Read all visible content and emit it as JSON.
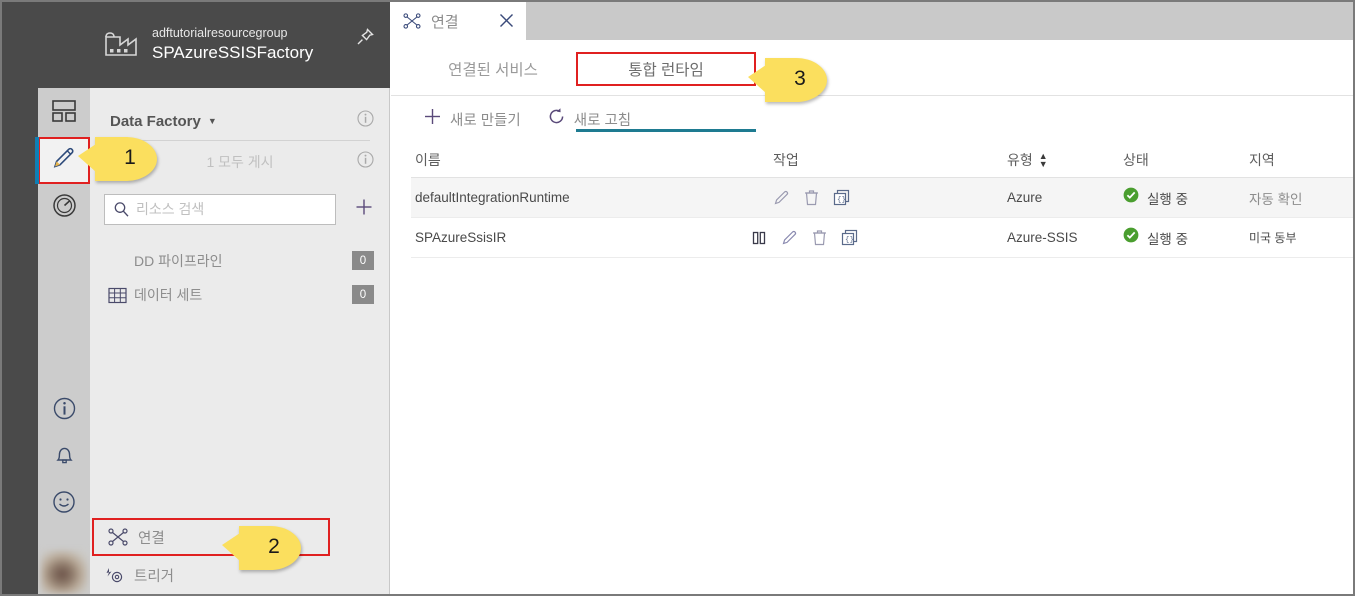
{
  "colors": {
    "accent_teal": "#1e7b91",
    "highlight_red": "#e02020",
    "callout_yellow": "#fbdf5e",
    "status_green": "#4a9e2f",
    "dark_chrome": "#4a4a4a"
  },
  "left_rail": {
    "items": [
      {
        "name": "overview-icon",
        "icon": "dashboard-icon"
      },
      {
        "name": "author-icon",
        "icon": "pencil-icon",
        "selected": true
      },
      {
        "name": "monitor-icon",
        "icon": "gauge-icon"
      }
    ],
    "bottom_items": [
      {
        "name": "info-icon",
        "icon": "info-circle-icon"
      },
      {
        "name": "notifications-icon",
        "icon": "bell-icon"
      },
      {
        "name": "feedback-icon",
        "icon": "smiley-icon"
      }
    ]
  },
  "header": {
    "resource_group": "adftutorialresourcegroup",
    "factory_name": "SPAzureSSISFactory",
    "factory_icon": "factory-icon",
    "pin_icon": "pin-icon"
  },
  "sidebar": {
    "title": "Data Factory",
    "caret": "▼",
    "publish_label": "1 모두 게시",
    "search": {
      "placeholder": "리소스 검색",
      "value": "",
      "icon": "search-icon"
    },
    "add_label": "+",
    "resources": [
      {
        "label": "DD 파이프라인",
        "count": "0",
        "icon": "pipeline-icon"
      },
      {
        "label": "데이터 세트",
        "count": "0",
        "icon": "table-icon"
      }
    ],
    "bottom": [
      {
        "label": "연결",
        "icon": "connections-icon",
        "highlighted": true
      },
      {
        "label": "트리거",
        "icon": "trigger-icon",
        "highlighted": false
      }
    ]
  },
  "tab": {
    "label": "연결",
    "icon": "connections-icon",
    "close_icon": "close-icon"
  },
  "subtabs": [
    {
      "label": "연결된 서비스",
      "active": false
    },
    {
      "label": "통합 런타임",
      "active": true
    }
  ],
  "toolbar": {
    "new_label": "새로 만들기",
    "new_icon": "plus-icon",
    "refresh_label": "새로 고침",
    "refresh_icon": "refresh-icon"
  },
  "table": {
    "columns": [
      {
        "label": "이름",
        "sortable": false
      },
      {
        "label": "작업",
        "sortable": false
      },
      {
        "label": "유형",
        "sortable": true
      },
      {
        "label": "상태",
        "sortable": false
      },
      {
        "label": "지역",
        "sortable": false
      }
    ],
    "rows": [
      {
        "name": "defaultIntegrationRuntime",
        "actions": [
          "edit-icon",
          "delete-icon",
          "code-icon"
        ],
        "type": "Azure",
        "status": "실행 중",
        "status_icon": "check-circle-icon",
        "region": "자동 확인"
      },
      {
        "name": "SPAzureSsisIR",
        "actions": [
          "pause-icon",
          "edit-icon",
          "delete-icon",
          "code-icon"
        ],
        "type": "Azure-SSIS",
        "status": "실행 중",
        "status_icon": "check-circle-icon",
        "region": "미국 동부"
      }
    ]
  },
  "callouts": [
    {
      "id": 1,
      "label": "1"
    },
    {
      "id": 2,
      "label": "2"
    },
    {
      "id": 3,
      "label": "3"
    }
  ]
}
